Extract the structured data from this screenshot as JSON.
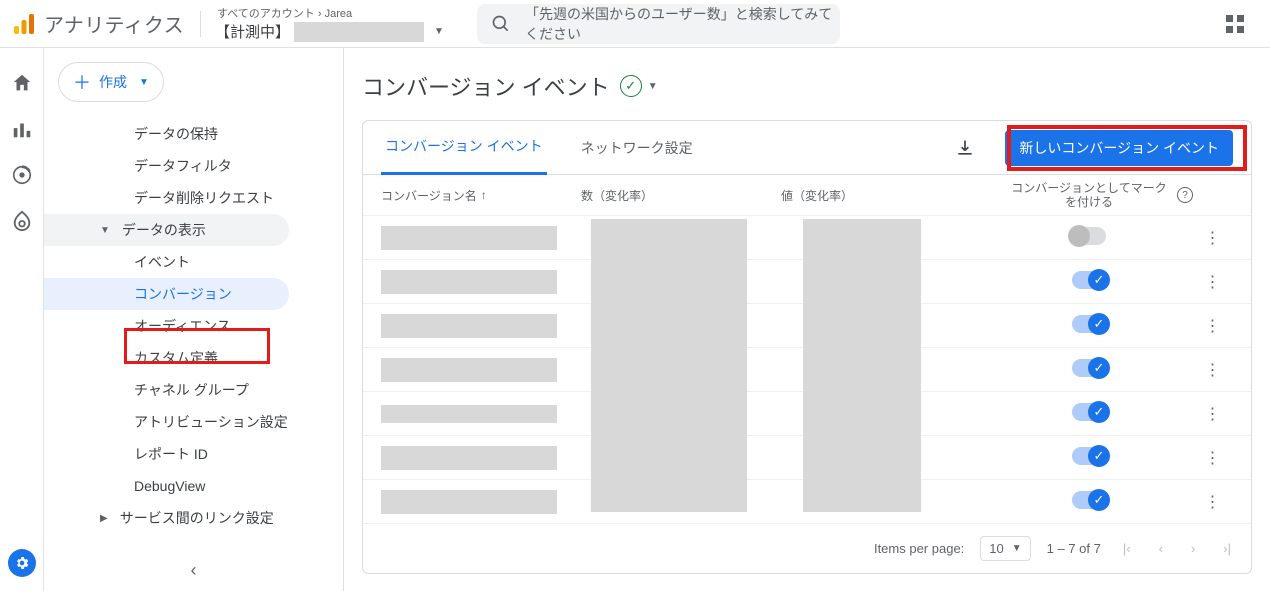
{
  "brand": "アナリティクス",
  "breadcrumb": {
    "top_left": "すべてのアカウント",
    "top_right": "Jarea",
    "property": "【計測中】"
  },
  "search": {
    "placeholder": "「先週の米国からのユーザー数」と検索してみてください"
  },
  "create_button": "作成",
  "nav": {
    "items_top": [
      "データの保持",
      "データフィルタ",
      "データ削除リクエスト"
    ],
    "group_display": "データの表示",
    "items_display": [
      "イベント",
      "コンバージョン",
      "オーディエンス",
      "カスタム定義",
      "チャネル グループ",
      "アトリビューション設定",
      "レポート ID",
      "DebugView"
    ],
    "group_link": "サービス間のリンク設定"
  },
  "page_title": "コンバージョン イベント",
  "tabs": {
    "active": "コンバージョン イベント",
    "inactive": "ネットワーク設定"
  },
  "new_button": "新しいコンバージョン イベント",
  "columns": {
    "name": "コンバージョン名",
    "count": "数（変化率）",
    "value": "値（変化率）",
    "mark": "コンバージョンとしてマークを付ける"
  },
  "rows": [
    {
      "toggle": "off"
    },
    {
      "toggle": "on"
    },
    {
      "toggle": "on"
    },
    {
      "toggle": "on"
    },
    {
      "toggle": "on"
    },
    {
      "toggle": "on"
    },
    {
      "toggle": "on"
    }
  ],
  "pager": {
    "label": "Items per page:",
    "size": "10",
    "range": "1 – 7 of 7"
  }
}
